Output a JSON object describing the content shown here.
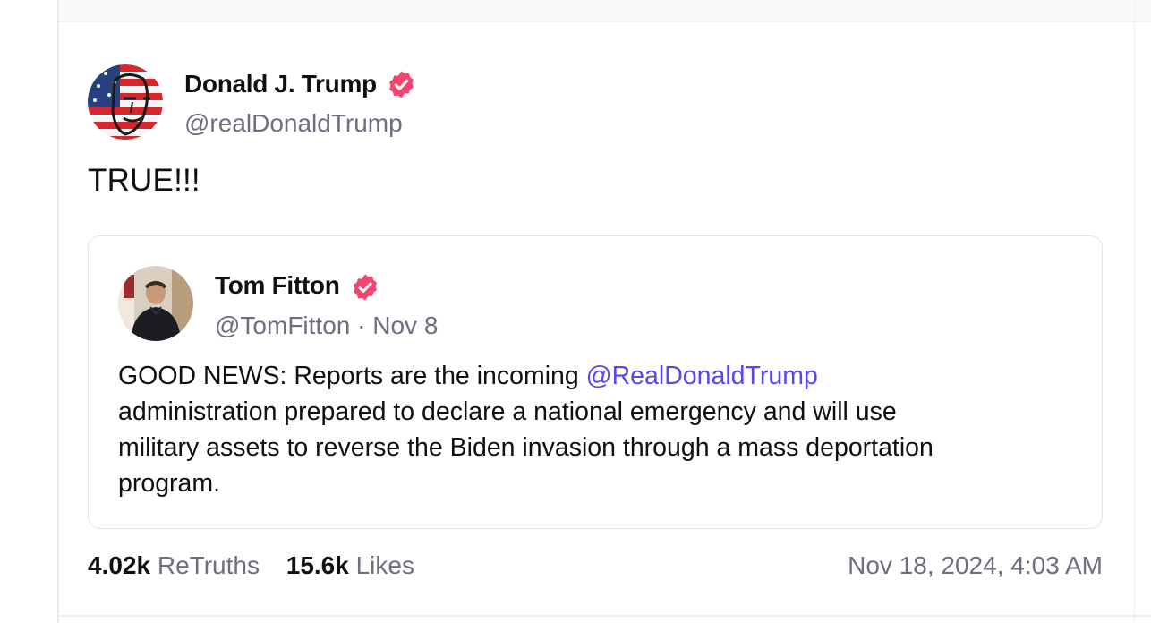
{
  "post": {
    "author": {
      "display_name": "Donald J. Trump",
      "handle": "@realDonaldTrump",
      "verified": true
    },
    "text": "TRUE!!!",
    "quoted": {
      "author": {
        "display_name": "Tom Fitton",
        "handle": "@TomFitton",
        "verified": true
      },
      "separator": " · ",
      "date": "Nov 8",
      "body": {
        "line1_prefix": "GOOD NEWS: Reports are the incoming ",
        "line1_mention": "@RealDonaldTrump",
        "line2": " administration prepared to declare a national emergency and will use",
        "line3": "military assets to reverse the Biden invasion through a mass deportation",
        "line4": "program."
      }
    },
    "stats": {
      "retruths_count": "4.02k",
      "retruths_label": " ReTruths",
      "likes_count": "15.6k",
      "likes_label": " Likes"
    },
    "timestamp": "Nov 18, 2024, 4:03 AM"
  },
  "colors": {
    "verified_badge": "#f2466f",
    "mention": "#5448ee",
    "muted_text": "#6f6e80",
    "primary_text": "#0f0f14",
    "card_border": "#e4e4ea"
  },
  "icons": {
    "verified": "verified-badge-icon"
  }
}
